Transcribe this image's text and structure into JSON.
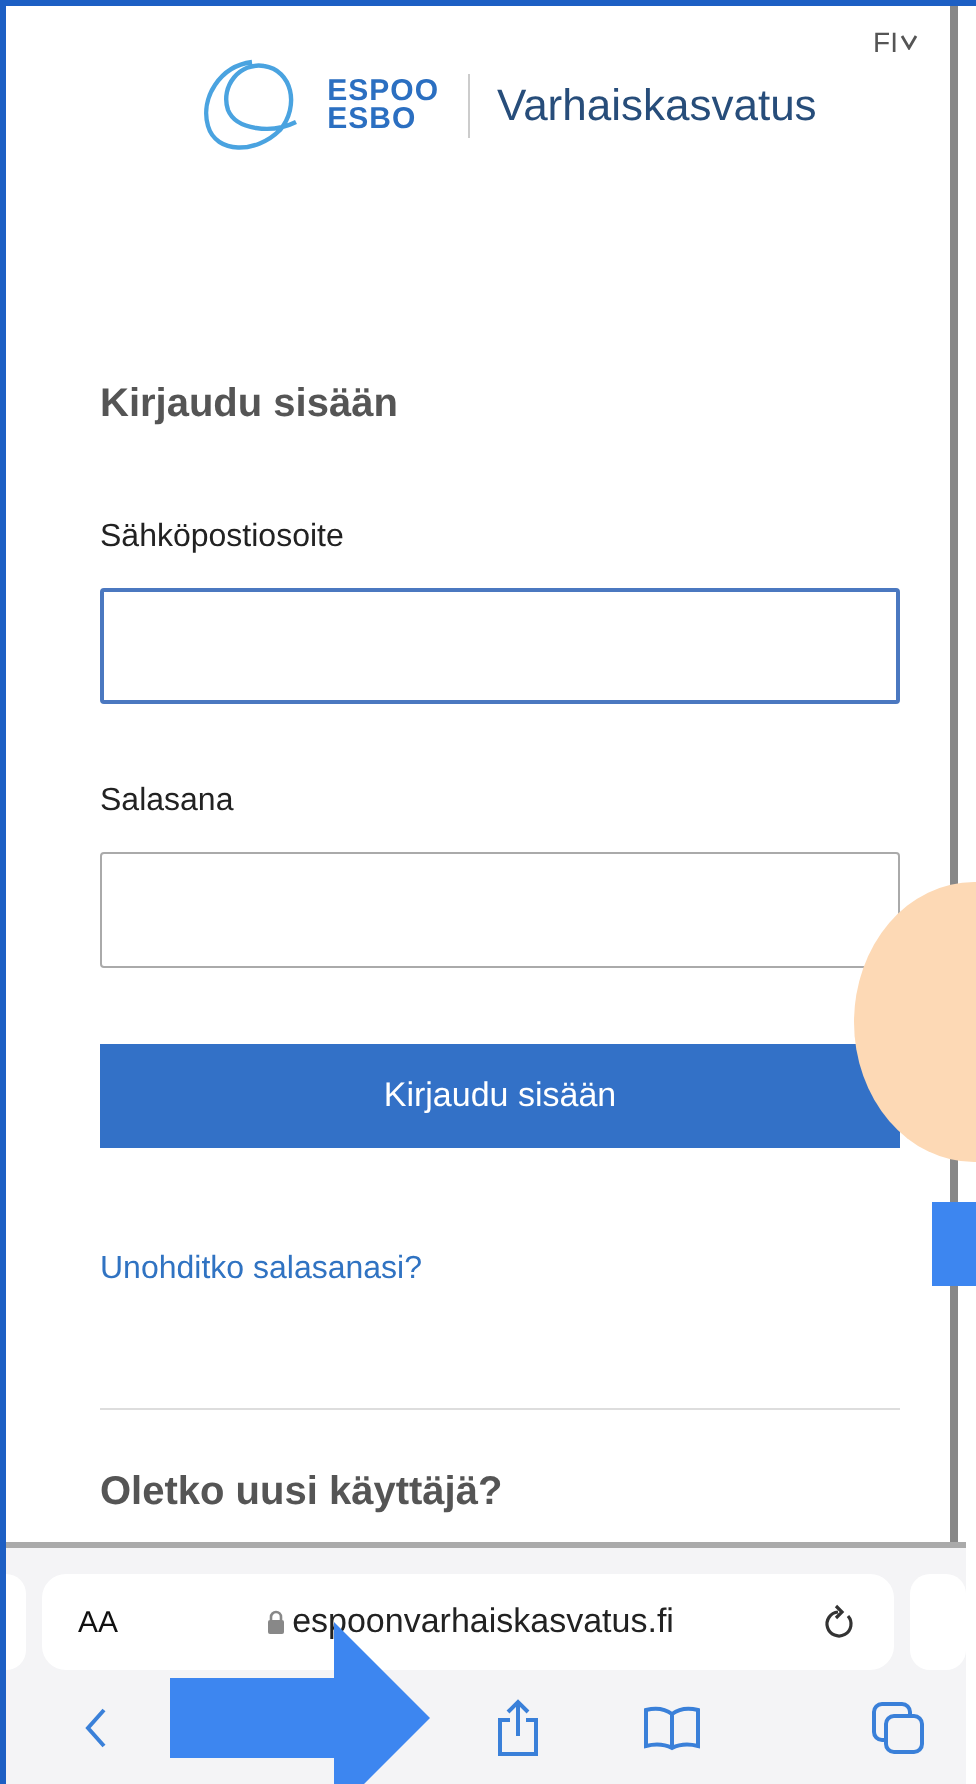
{
  "header": {
    "logo_top": "ESPOO",
    "logo_bottom": "ESBO",
    "service": "Varhaiskasvatus",
    "language": "FI"
  },
  "login": {
    "title": "Kirjaudu sisään",
    "fields": [
      {
        "label": "Sähköpostiosoite",
        "focused": true
      },
      {
        "label": "Salasana",
        "focused": false
      }
    ],
    "submit": "Kirjaudu sisään",
    "forgot_link": "Unohditko salasanasi?"
  },
  "signup": {
    "title": "Oletko uusi käyttäjä?"
  },
  "browser": {
    "text_size": "AA",
    "url": "espoonvarhaiskasvatus.fi"
  }
}
